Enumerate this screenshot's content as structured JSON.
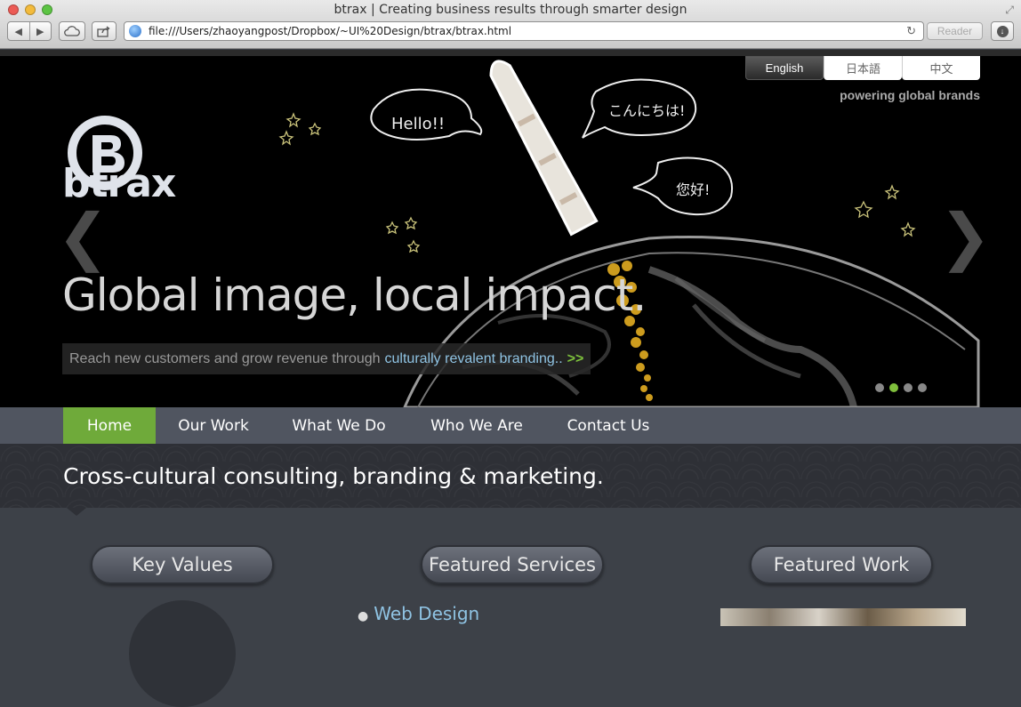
{
  "browser": {
    "window_title": "btrax | Creating business results through smarter design",
    "url": "file:///Users/zhaoyangpost/Dropbox/~UI%20Design/btrax/btrax.html",
    "reader_label": "Reader"
  },
  "hero": {
    "languages": [
      "English",
      "日本語",
      "中文"
    ],
    "tagline": "powering global brands",
    "logo_text": "btrax",
    "headline": "Global image, local impact.",
    "sub_plain": "Reach new customers and grow revenue through",
    "sub_link": "culturally revalent branding..",
    "sub_more": ">>",
    "bubbles": [
      "Hello!!",
      "こんにちは!",
      "您好!"
    ],
    "slides_total": 4,
    "slide_active": 2
  },
  "nav": {
    "items": [
      "Home",
      "Our Work",
      "What We Do",
      "Who We Are",
      "Contact Us"
    ],
    "active": "Home"
  },
  "banner": {
    "text": "Cross-cultural consulting, branding & marketing."
  },
  "sections": {
    "key_values": "Key Values",
    "featured_services": "Featured Services",
    "featured_work": "Featured Work",
    "services": [
      "Web Design"
    ]
  },
  "colors": {
    "accent_green": "#6faa3a",
    "link_blue": "#8fc3e3"
  }
}
